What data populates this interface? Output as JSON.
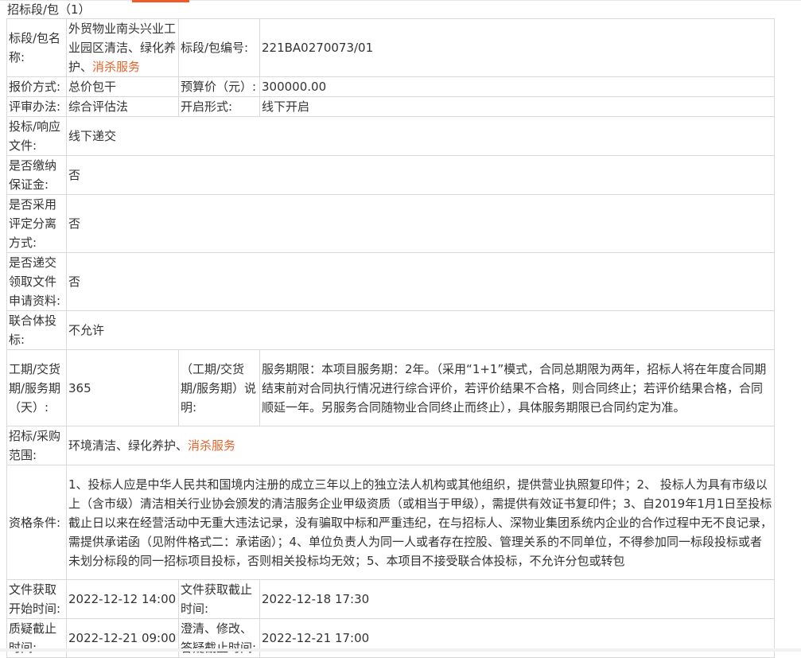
{
  "section_title": "招标段/包（1）",
  "rows": {
    "section_name": {
      "label": "标段/包名称:",
      "value_main": "外贸物业南头兴业工业园区清洁、绿化养护、",
      "value_highlight": "消杀服务"
    },
    "section_code": {
      "label": "标段/包编号:",
      "value": "221BA0270073/01"
    },
    "quote_method": {
      "label": "报价方式:",
      "value": "总价包干"
    },
    "budget": {
      "label": "预算价（元）:",
      "value": "300000.00"
    },
    "review_method": {
      "label": "评审办法:",
      "value": "综合评估法"
    },
    "open_form": {
      "label": "开启形式:",
      "value": "线下开启"
    },
    "bid_doc": {
      "label": "投标/响应文件:",
      "value": "线下递交"
    },
    "deposit": {
      "label": "是否缴纳保证金:",
      "value": "否"
    },
    "separation": {
      "label": "是否采用评定分离方式:",
      "value": "否"
    },
    "apply_docs": {
      "label": "是否递交领取文件申请资料:",
      "value": "否"
    },
    "consortium": {
      "label": "联合体投标:",
      "value": "不允许"
    },
    "duration": {
      "label": "工期/交货期/服务期（天）:",
      "value": "365"
    },
    "duration_note": {
      "label": "（工期/交货期/服务期）说明:",
      "value": "服务期限：本项目服务期：2年。（采用“1+1”模式，合同总期限为两年，招标人将在年度合同期结束前对合同执行情况进行综合评价，若评价结果不合格，则合同终止；若评价结果合格，合同顺延一年。另服务合同随物业合同终止而终止），具体服务期限已合同约定为准。"
    },
    "scope": {
      "label": "招标/采购范围:",
      "value_main": "环境清洁、绿化养护、",
      "value_highlight": "消杀服务"
    },
    "qualification": {
      "label": "资格条件:",
      "value": "1、投标人应是中华人民共和国境内注册的成立三年以上的独立法人机构或其他组织，提供营业执照复印件；2、 投标人为具有市级以上（含市级）清洁相关行业协会颁发的清洁服务企业甲级资质（或相当于甲级），需提供有效证书复印件；3、自2019年1月1日至投标截止日以来在经营活动中无重大违法记录，没有骗取中标和严重违纪，在与招标人、深物业集团系统内企业的合作过程中无不良记录，需提供承诺函（见附件格式二：承诺函）；4、单位负责人为同一人或者存在控股、管理关系的不同单位，不得参加同一标段投标或者未划分标段的同一招标项目投标，否则相关投标均无效；5、本项目不接受联合体投标，不允许分包或转包"
    },
    "doc_start": {
      "label": "文件获取开始时间:",
      "value": "2022-12-12 14:00"
    },
    "doc_end": {
      "label": "文件获取截止时间:",
      "value": "2022-12-18 17:30"
    },
    "query_end": {
      "label": "质疑截止时间:",
      "value": "2022-12-21 09:00"
    },
    "clarify_end": {
      "label": "澄清、修改、答疑截止时间:",
      "value": "2022-12-21 17:00"
    }
  },
  "colors": {
    "highlight": "#e8632a",
    "border": "#d9d9d9",
    "text": "#333333"
  }
}
